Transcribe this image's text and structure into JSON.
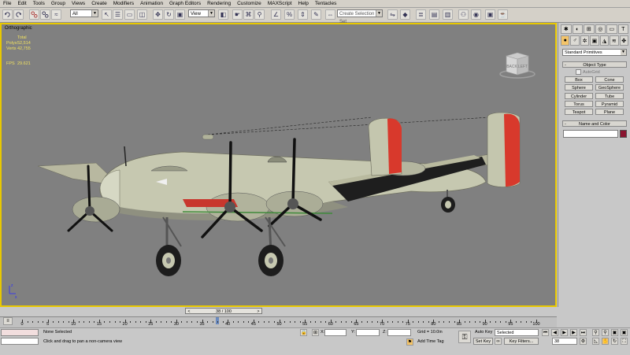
{
  "menu": [
    "File",
    "Edit",
    "Tools",
    "Group",
    "Views",
    "Create",
    "Modifiers",
    "Animation",
    "Graph Editors",
    "Rendering",
    "Customize",
    "MAXScript",
    "Help",
    "Tentacles"
  ],
  "toolbar": {
    "filter_value": "All",
    "coord_value": "View",
    "selection_set_placeholder": "Create Selection Set"
  },
  "viewport": {
    "label": "Orthographic",
    "stats_header": "Total",
    "stats": [
      {
        "key": "Polys",
        "value": "52,514"
      },
      {
        "key": "Verts",
        "value": "42,755"
      }
    ],
    "fps_key": "FPS",
    "fps_value": "29.621",
    "viewcube_faces": [
      "BACK",
      "LEFT"
    ],
    "colors": {
      "viewport_bg": "#808080",
      "border": "#e8c800",
      "stats": "#f0e060"
    }
  },
  "command_panel": {
    "tabs": [
      "create-icon",
      "modify-icon",
      "hierarchy-icon",
      "motion-icon",
      "display-icon",
      "utilities-icon"
    ],
    "category_icons": [
      "geometry-icon",
      "shapes-icon",
      "lights-icon",
      "cameras-icon",
      "helpers-icon",
      "spacewarps-icon",
      "systems-icon"
    ],
    "primitive_type": "Standard Primitives",
    "object_type_header": "Object Type",
    "autogrid_label": "AutoGrid",
    "buttons": [
      "Box",
      "Cone",
      "Sphere",
      "GeoSphere",
      "Cylinder",
      "Tube",
      "Torus",
      "Pyramid",
      "Teapot",
      "Plane"
    ],
    "name_color_header": "Name and Color",
    "name_value": "",
    "color_swatch": "#8a1530"
  },
  "timeline": {
    "slider_text": "38 / 100",
    "slider_prev": "<",
    "slider_next": ">",
    "current_frame": 38,
    "total_frames": 100,
    "ticks": [
      "0",
      "5",
      "10",
      "15",
      "20",
      "25",
      "30",
      "35",
      "40",
      "45",
      "50",
      "55",
      "60",
      "65",
      "70",
      "75",
      "80",
      "85",
      "90",
      "95",
      "100"
    ]
  },
  "status": {
    "selection": "None Selected",
    "prompt": "Click and drag to pan a non-camera view",
    "x_label": "X:",
    "y_label": "Y:",
    "z_label": "Z:",
    "x_value": "",
    "y_value": "",
    "z_value": "",
    "grid": "Grid = 10.0in",
    "add_time_tag": "Add Time Tag",
    "auto_key": "Auto Key",
    "set_key": "Set Key",
    "key_mode_value": "Selected",
    "key_filters": "Key Filters...",
    "frame_value": "38"
  }
}
